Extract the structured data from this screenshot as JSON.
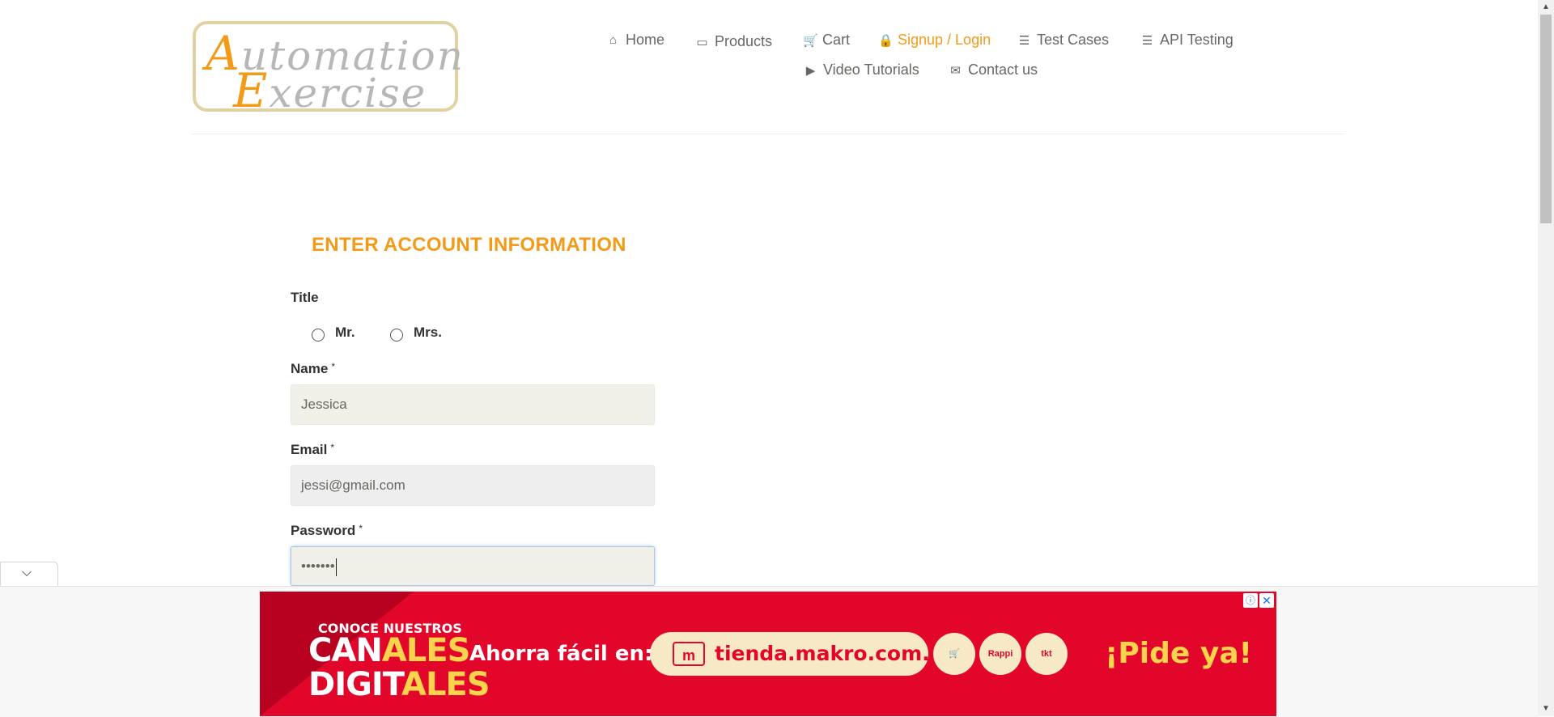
{
  "logo": {
    "line1_cap": "A",
    "line1_rest": "utomation",
    "line2_cap": "E",
    "line2_rest": "xercise"
  },
  "nav": {
    "items": [
      {
        "label": "Home",
        "icon": "home-icon",
        "active": false
      },
      {
        "label": "Products",
        "icon": "briefcase-icon",
        "active": false
      },
      {
        "label": "Cart",
        "icon": "cart-icon",
        "active": false
      },
      {
        "label": "Signup / Login",
        "icon": "lock-icon",
        "active": true
      },
      {
        "label": "Test Cases",
        "icon": "list-icon",
        "active": false
      },
      {
        "label": "API Testing",
        "icon": "list-icon",
        "active": false
      },
      {
        "label": "Video Tutorials",
        "icon": "youtube-play-icon",
        "active": false
      },
      {
        "label": "Contact us",
        "icon": "envelope-icon",
        "active": false
      }
    ]
  },
  "form": {
    "title": "ENTER ACCOUNT INFORMATION",
    "title_label": "Title",
    "mr_label": "Mr.",
    "mrs_label": "Mrs.",
    "name_label": "Name",
    "name_value": "Jessica",
    "email_label": "Email",
    "email_value": "jessi@gmail.com",
    "password_label": "Password",
    "password_value": "•••••••",
    "required_mark": "*"
  },
  "ad": {
    "conoce": "CONOCE NUESTROS",
    "canales_a": "CAN",
    "canales_b": "ALES",
    "digitales_a": "DIGIT",
    "digitales_b": "ALES",
    "ahorra": "Ahorra fácil en:",
    "url": "tienda.makro.com.co",
    "pill_icon": "m",
    "circle1": "🛒",
    "circle2": "Rappi",
    "circle3": "tkt",
    "cta": "¡Pide ya!",
    "info": "ⓘ",
    "close": "✕"
  },
  "colors": {
    "accent": "#f39a17",
    "text": "#696763",
    "ad_red": "#e3062b"
  }
}
